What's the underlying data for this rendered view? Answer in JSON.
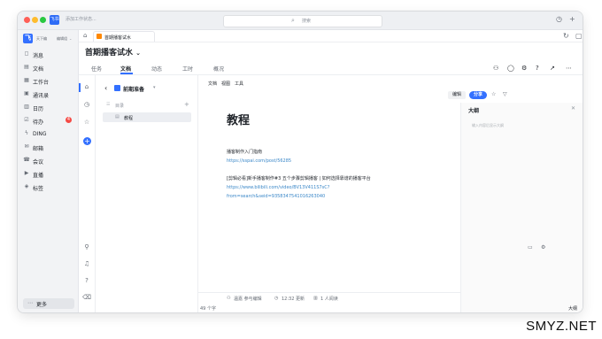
{
  "titlebar": {
    "app_badge": "飞书",
    "add_status": "添加工作状态...",
    "search_placeholder": "搜索",
    "colors": {
      "close": "#fe5f57",
      "min": "#febc2e",
      "max": "#28c840"
    }
  },
  "sidebar": {
    "org_badge": "飞",
    "org_name": "天下编",
    "org_name2": "编辑组",
    "items": [
      {
        "icon": "chat-icon",
        "glyph": "◻",
        "label": "消息"
      },
      {
        "icon": "doc-icon",
        "glyph": "▤",
        "label": "文档"
      },
      {
        "icon": "workbench-icon",
        "glyph": "▦",
        "label": "工作台"
      },
      {
        "icon": "contacts-icon",
        "glyph": "▣",
        "label": "通讯录"
      },
      {
        "icon": "calendar-icon",
        "glyph": "▥",
        "label": "日历"
      },
      {
        "icon": "todo-icon",
        "glyph": "☑",
        "label": "待办",
        "badge": "4"
      },
      {
        "icon": "ding-icon",
        "glyph": "ϟ",
        "label": "DING"
      },
      {
        "icon": "mail-icon",
        "glyph": "✉",
        "label": "邮箱"
      },
      {
        "icon": "meeting-icon",
        "glyph": "☎",
        "label": "会议"
      },
      {
        "icon": "live-icon",
        "glyph": "▶",
        "label": "直播"
      },
      {
        "icon": "bookmark-icon",
        "glyph": "◈",
        "label": "标签"
      }
    ],
    "more_label": "更多"
  },
  "workspace": {
    "tab_title": "首期播客试水",
    "project_title": "首期播客试水",
    "nav_tabs": [
      "任务",
      "文档",
      "动态",
      "工时",
      "概况"
    ],
    "active_tab": 1
  },
  "tree": {
    "workspace_name": "前期准备",
    "dir_label": "目录",
    "selected_doc": "教程"
  },
  "editor": {
    "menu": [
      "文档",
      "视图",
      "工具"
    ],
    "title": "教程",
    "line1": "播客制作入门指南",
    "link1": "https://sspai.com/post/56285",
    "line2": "[剪辑必看]新手播客制作#3 五个步骤剪辑播客 | 如何选择靠谱的播客平台",
    "link2a": "https://www.bilibili.com/video/BV13V411S7sC?",
    "link2b": "from=search&seid=9358347541016263040",
    "footer_author": "温嘉 参与编辑",
    "footer_time": "12:32 更新",
    "footer_readers": "1 人阅读",
    "wordcount": "49 个字"
  },
  "actions": {
    "edit_label": "编辑",
    "share_label": "分享"
  },
  "outline": {
    "title": "大纲",
    "hint": "输入内容后显示大纲",
    "footer": "大纲"
  },
  "watermark": "SMYZ.NET"
}
